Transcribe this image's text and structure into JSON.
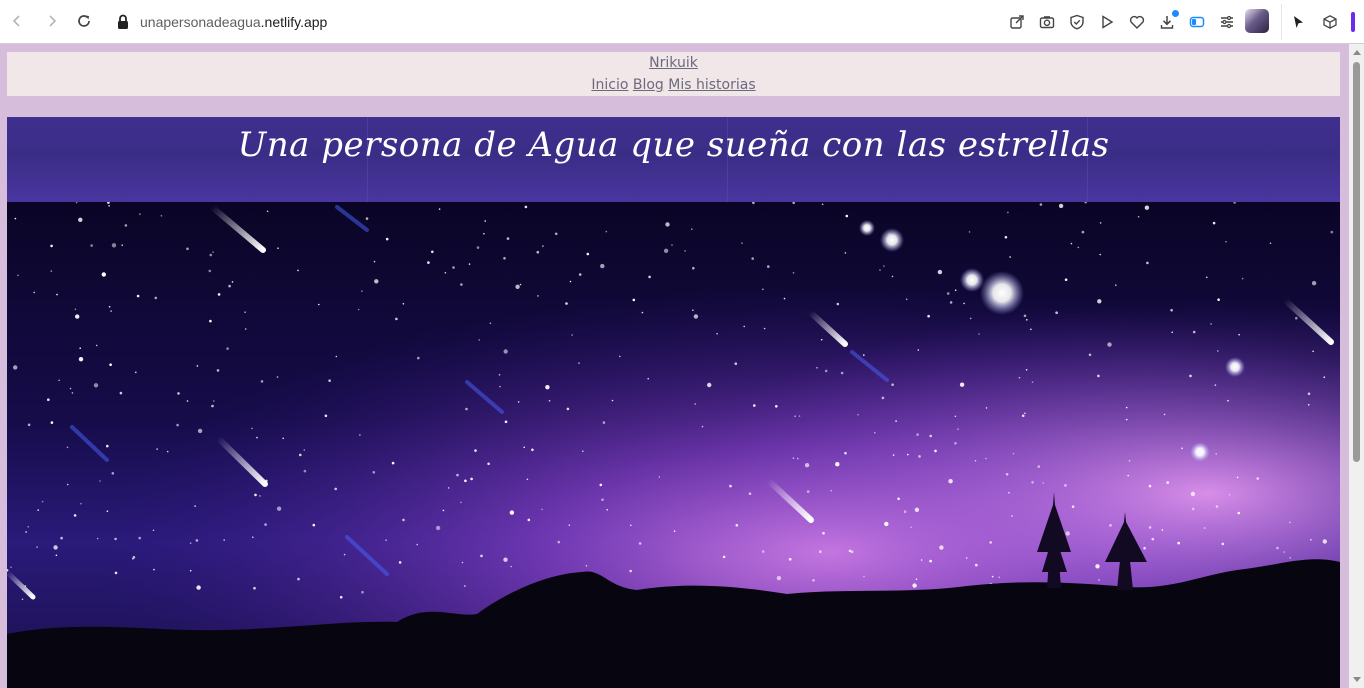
{
  "browser": {
    "url_host_prefix": "unapersonadeagua",
    "url_host": ".netlify.app",
    "icons": [
      "back-icon",
      "forward-icon",
      "reload-icon",
      "lock-icon",
      "share-icon",
      "camera-icon",
      "shield-icon",
      "play-icon",
      "heart-icon",
      "download-icon",
      "sidebar-icon",
      "menu-icon",
      "avatar",
      "cursor-icon",
      "cube-icon"
    ]
  },
  "site": {
    "brand": "Nrikuik",
    "nav": [
      {
        "label": "Inicio"
      },
      {
        "label": "Blog"
      },
      {
        "label": "Mis historias"
      }
    ],
    "title": "Una persona de Agua que sueña con las estrellas"
  },
  "colors": {
    "page_bg": "#d6bddb",
    "nav_bg": "#f1e6e8",
    "title_band": "#3f2f8f",
    "link": "#6b6b7d"
  }
}
